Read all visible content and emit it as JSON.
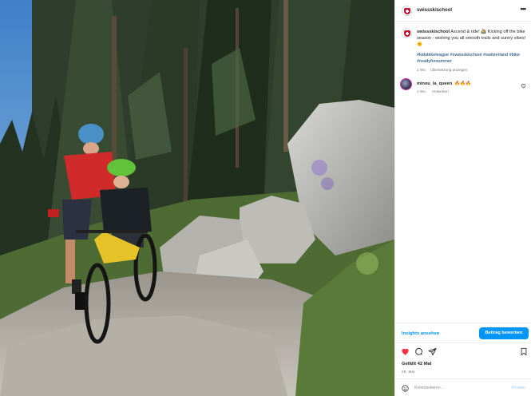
{
  "post": {
    "author": "swissskischool",
    "more_icon": "more-horizontal-icon",
    "caption_text": "Ascend & ride! 🚵 Kicking off the bike season - wishing you all smooth trails and sunny vibes! 🌞",
    "hashtags": "#kidsbikeleague #swissskischool #switzerland #bike #readyforsummer",
    "caption_age": "1 Wo.",
    "see_translation": "Übersetzung anzeigen",
    "likes": "Gefällt 42 Mal",
    "date": "28. Mai"
  },
  "comment": {
    "user": "minou_la_queen",
    "text": "🔥🔥🔥",
    "age": "1 Wo.",
    "reply": "Antworten"
  },
  "insights": {
    "link": "Insights ansehen",
    "boost_button": "Beitrag bewerben"
  },
  "add_comment": {
    "placeholder": "Kommentieren ...",
    "post_label": "Posten"
  },
  "icons": {
    "like": "heart-filled-icon",
    "comment": "comment-icon",
    "share": "share-icon",
    "save": "bookmark-icon",
    "emoji": "emoji-icon"
  },
  "colors": {
    "accent": "#0095f6",
    "like": "#ff3040",
    "hashtag": "#00376b",
    "muted": "#737373"
  }
}
